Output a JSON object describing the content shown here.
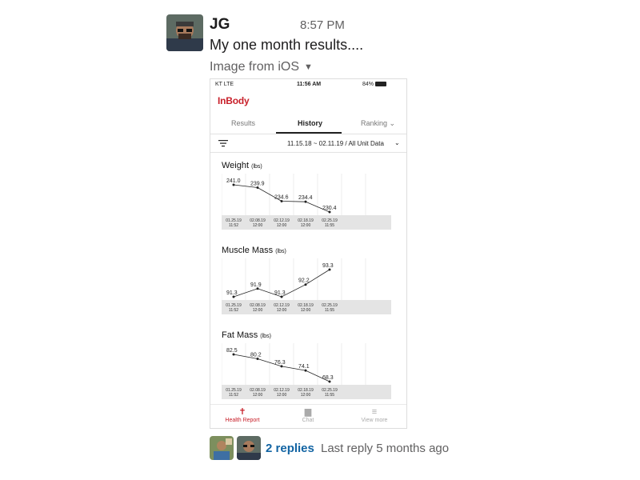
{
  "message": {
    "author": "JG",
    "time": "8:57 PM",
    "text": "My one month results....",
    "image_label": "Image from iOS"
  },
  "phone": {
    "status": {
      "carrier": "KT  LTE",
      "clock": "11:56 AM",
      "battery": "84%"
    },
    "app_name": "InBody",
    "tabs": [
      "Results",
      "History",
      "Ranking ⌄"
    ],
    "active_tab": "History",
    "filter_text": "11.15.18 ~ 02.11.19 / All Unit Data",
    "bottom_nav": [
      {
        "label": "Health Report",
        "icon": "person-icon",
        "active": true
      },
      {
        "label": "Chat",
        "icon": "chat-icon",
        "active": false
      },
      {
        "label": "View more",
        "icon": "menu-icon",
        "active": false
      }
    ]
  },
  "charts": [
    {
      "title": "Weight",
      "unit": "(lbs)",
      "x": [
        [
          "01.25.19",
          "11:52"
        ],
        [
          "02.08.19",
          "12:00"
        ],
        [
          "02.12.19",
          "12:00"
        ],
        [
          "02.18.19",
          "12:00"
        ],
        [
          "02.25.19",
          "11:55"
        ]
      ],
      "values": [
        241.0,
        239.9,
        234.6,
        234.4,
        230.4
      ],
      "labels": [
        "241.0",
        "239.9",
        "234.6",
        "234.4",
        "230.4"
      ]
    },
    {
      "title": "Muscle Mass",
      "unit": "(lbs)",
      "x": [
        [
          "01.25.19",
          "11:52"
        ],
        [
          "02.08.19",
          "12:00"
        ],
        [
          "02.12.19",
          "12:00"
        ],
        [
          "02.18.19",
          "12:00"
        ],
        [
          "02.25.19",
          "11:55"
        ]
      ],
      "values": [
        91.3,
        91.9,
        91.3,
        92.2,
        93.3
      ],
      "labels": [
        "91.3",
        "91.9",
        "91.3",
        "92.2",
        "93.3"
      ]
    },
    {
      "title": "Fat Mass",
      "unit": "(lbs)",
      "x": [
        [
          "01.25.19",
          "11:52"
        ],
        [
          "02.08.19",
          "12:00"
        ],
        [
          "02.12.19",
          "12:00"
        ],
        [
          "02.18.19",
          "12:00"
        ],
        [
          "02.25.19",
          "11:55"
        ]
      ],
      "values": [
        82.5,
        80.2,
        76.3,
        74.1,
        68.3
      ],
      "labels": [
        "82.5",
        "80.2",
        "76.3",
        "74.1",
        "68.3"
      ]
    }
  ],
  "thread": {
    "reply_count": "2 replies",
    "last_reply": "Last reply 5 months ago"
  },
  "colors": {
    "link": "#1264a3",
    "brand": "#c8202a"
  }
}
